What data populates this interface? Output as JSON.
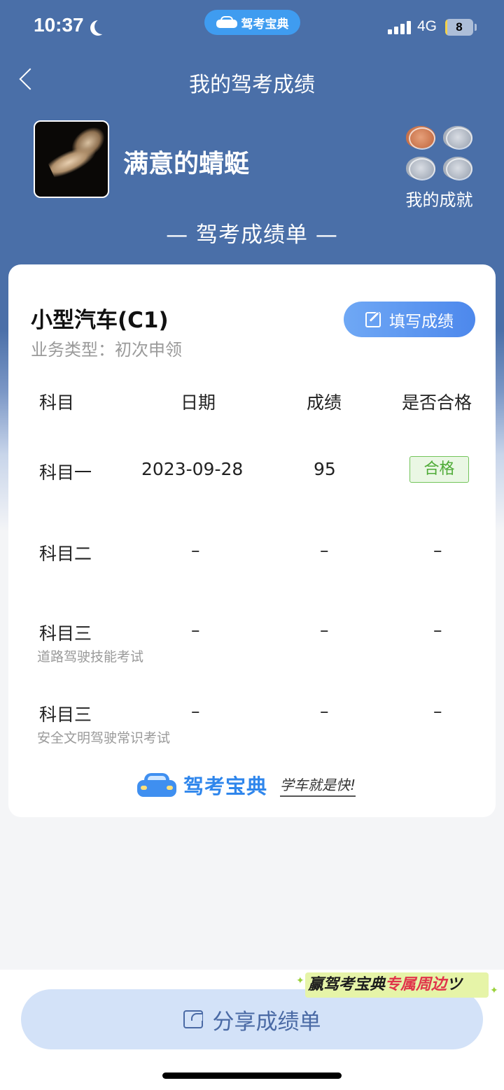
{
  "status_bar": {
    "time": "10:37",
    "app_pill": "驾考宝典",
    "network": "4G",
    "battery": "8",
    "battery_level_percent": 8
  },
  "nav": {
    "title": "我的驾考成绩",
    "back_icon": "chevron-left-icon"
  },
  "profile": {
    "username": "满意的蜻蜓",
    "achievements_label": "我的成就",
    "medal_icons": [
      "bronze-medal-icon",
      "silver-medal-icon",
      "silver-medal-icon",
      "silver-medal-icon"
    ]
  },
  "report_heading": "— 驾考成绩单 —",
  "card": {
    "license": "小型汽车(C1)",
    "business_type": "业务类型：初次申领",
    "fill_button": "填写成绩",
    "headers": [
      "科目",
      "日期",
      "成绩",
      "是否合格"
    ],
    "rows": [
      {
        "subject": "科目一",
        "note": "",
        "date": "2023-09-28",
        "score": "95",
        "result": "合格"
      },
      {
        "subject": "科目二",
        "note": "",
        "date": "–",
        "score": "–",
        "result": "–"
      },
      {
        "subject": "科目三",
        "note": "道路驾驶技能考试",
        "date": "–",
        "score": "–",
        "result": "–"
      },
      {
        "subject": "科目三",
        "note": "安全文明驾驶常识考试",
        "date": "–",
        "score": "–",
        "result": "–"
      }
    ],
    "brand_name": "驾考宝典",
    "brand_slogan": "学车就是快!"
  },
  "promo": {
    "text_a": "赢驾考宝典",
    "text_b": "专属周边",
    "text_c": "ツ"
  },
  "share_button": "分享成绩单",
  "colors": {
    "header_blue": "#4a6fa8",
    "accent_blue": "#4d88ec",
    "pass_green": "#4fab37"
  }
}
